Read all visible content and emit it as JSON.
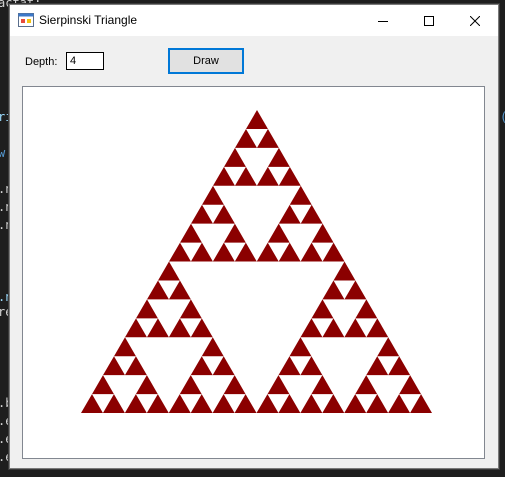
{
  "window": {
    "title": "Sierpinski Triangle",
    "icon": "app-icon",
    "controls": {
      "minimize": "minimize-icon",
      "maximize": "maximize-icon",
      "close": "close-icon"
    }
  },
  "toolbar": {
    "depth_label": "Depth:",
    "depth_value": "4",
    "draw_label": "Draw"
  },
  "canvas": {
    "fractal": "sierpinski-triangle",
    "depth": 4,
    "fill_color": "#8b0000",
    "background": "#ffffff"
  },
  "colors": {
    "focus_border": "#0078d7",
    "editor_bg": "#1e1e1e"
  }
}
